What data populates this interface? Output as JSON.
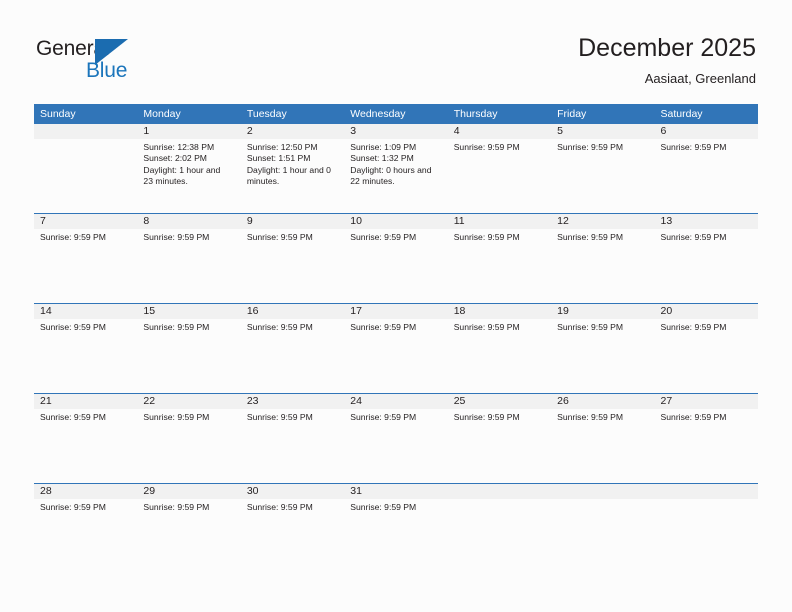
{
  "brand": {
    "name_top": "General",
    "name_bottom": "Blue",
    "accent_color": "#1b75bb",
    "triangle_color": "#1b6cb0"
  },
  "header": {
    "title": "December 2025",
    "subtitle": "Aasiaat, Greenland"
  },
  "theme": {
    "header_blue": "#3175b8",
    "date_band_gray": "#f1f1f1",
    "page_background": "#fcfcfc",
    "text_color": "#231f20"
  },
  "weekdays": [
    "Sunday",
    "Monday",
    "Tuesday",
    "Wednesday",
    "Thursday",
    "Friday",
    "Saturday"
  ],
  "weeks": [
    {
      "days": [
        {
          "date": "",
          "lines": []
        },
        {
          "date": "1",
          "lines": [
            "Sunrise: 12:38 PM",
            "Sunset: 2:02 PM",
            "Daylight: 1 hour and 23 minutes."
          ]
        },
        {
          "date": "2",
          "lines": [
            "Sunrise: 12:50 PM",
            "Sunset: 1:51 PM",
            "Daylight: 1 hour and 0 minutes."
          ]
        },
        {
          "date": "3",
          "lines": [
            "Sunrise: 1:09 PM",
            "Sunset: 1:32 PM",
            "Daylight: 0 hours and 22 minutes."
          ]
        },
        {
          "date": "4",
          "lines": [
            "Sunrise: 9:59 PM"
          ]
        },
        {
          "date": "5",
          "lines": [
            "Sunrise: 9:59 PM"
          ]
        },
        {
          "date": "6",
          "lines": [
            "Sunrise: 9:59 PM"
          ]
        }
      ]
    },
    {
      "days": [
        {
          "date": "7",
          "lines": [
            "Sunrise: 9:59 PM"
          ]
        },
        {
          "date": "8",
          "lines": [
            "Sunrise: 9:59 PM"
          ]
        },
        {
          "date": "9",
          "lines": [
            "Sunrise: 9:59 PM"
          ]
        },
        {
          "date": "10",
          "lines": [
            "Sunrise: 9:59 PM"
          ]
        },
        {
          "date": "11",
          "lines": [
            "Sunrise: 9:59 PM"
          ]
        },
        {
          "date": "12",
          "lines": [
            "Sunrise: 9:59 PM"
          ]
        },
        {
          "date": "13",
          "lines": [
            "Sunrise: 9:59 PM"
          ]
        }
      ]
    },
    {
      "days": [
        {
          "date": "14",
          "lines": [
            "Sunrise: 9:59 PM"
          ]
        },
        {
          "date": "15",
          "lines": [
            "Sunrise: 9:59 PM"
          ]
        },
        {
          "date": "16",
          "lines": [
            "Sunrise: 9:59 PM"
          ]
        },
        {
          "date": "17",
          "lines": [
            "Sunrise: 9:59 PM"
          ]
        },
        {
          "date": "18",
          "lines": [
            "Sunrise: 9:59 PM"
          ]
        },
        {
          "date": "19",
          "lines": [
            "Sunrise: 9:59 PM"
          ]
        },
        {
          "date": "20",
          "lines": [
            "Sunrise: 9:59 PM"
          ]
        }
      ]
    },
    {
      "days": [
        {
          "date": "21",
          "lines": [
            "Sunrise: 9:59 PM"
          ]
        },
        {
          "date": "22",
          "lines": [
            "Sunrise: 9:59 PM"
          ]
        },
        {
          "date": "23",
          "lines": [
            "Sunrise: 9:59 PM"
          ]
        },
        {
          "date": "24",
          "lines": [
            "Sunrise: 9:59 PM"
          ]
        },
        {
          "date": "25",
          "lines": [
            "Sunrise: 9:59 PM"
          ]
        },
        {
          "date": "26",
          "lines": [
            "Sunrise: 9:59 PM"
          ]
        },
        {
          "date": "27",
          "lines": [
            "Sunrise: 9:59 PM"
          ]
        }
      ]
    },
    {
      "days": [
        {
          "date": "28",
          "lines": [
            "Sunrise: 9:59 PM"
          ]
        },
        {
          "date": "29",
          "lines": [
            "Sunrise: 9:59 PM"
          ]
        },
        {
          "date": "30",
          "lines": [
            "Sunrise: 9:59 PM"
          ]
        },
        {
          "date": "31",
          "lines": [
            "Sunrise: 9:59 PM"
          ]
        },
        {
          "date": "",
          "lines": []
        },
        {
          "date": "",
          "lines": []
        },
        {
          "date": "",
          "lines": []
        }
      ]
    }
  ]
}
